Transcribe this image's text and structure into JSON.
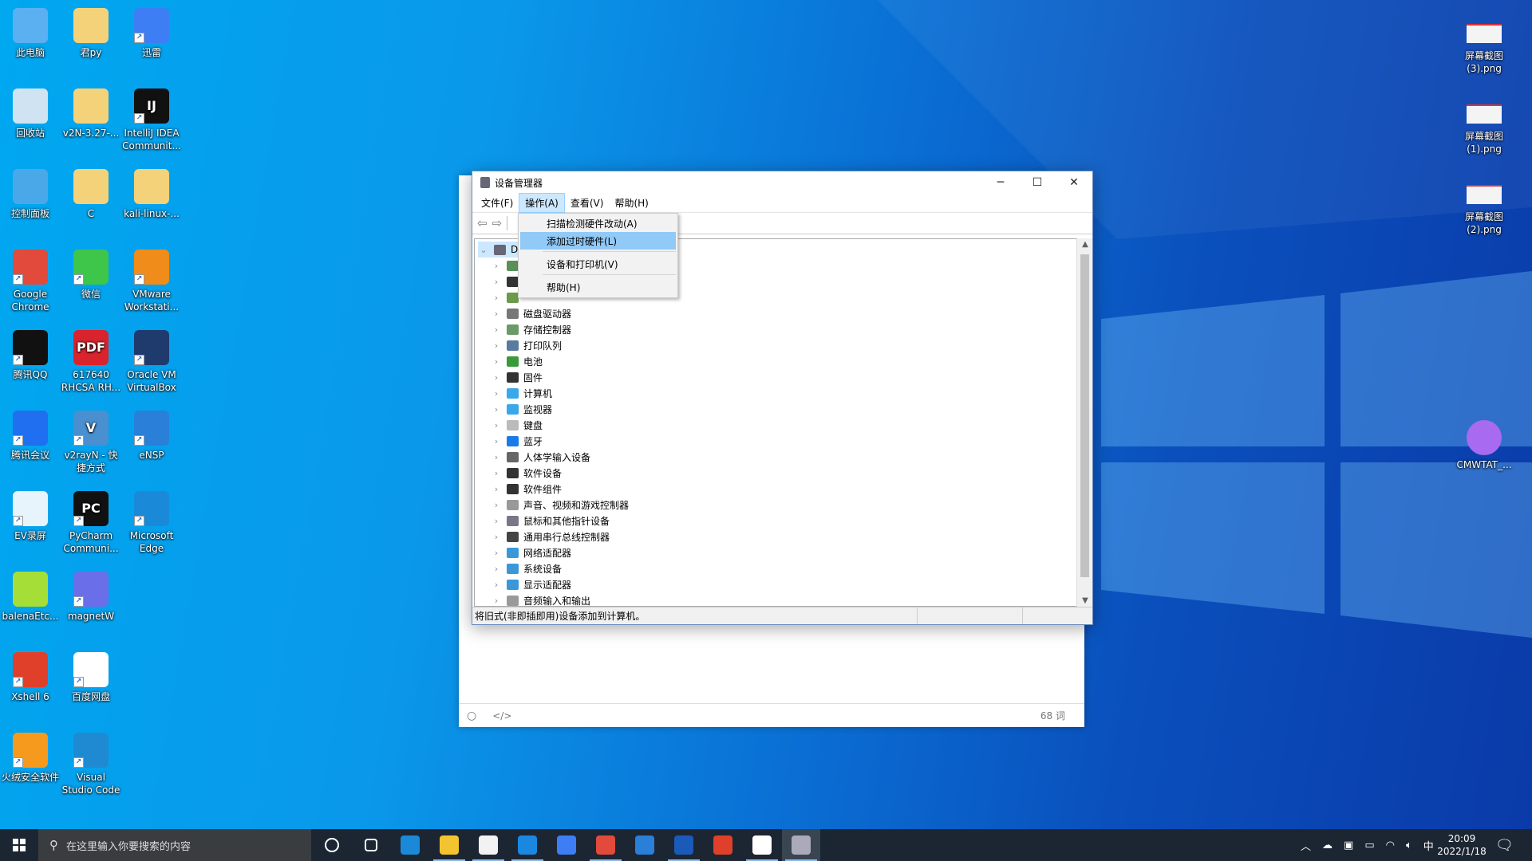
{
  "desktop": {
    "left_icons": [
      {
        "label": "此电脑",
        "icon": "computer-icon",
        "color": "#5ab0f0",
        "col": 0,
        "row": 0
      },
      {
        "label": "君py",
        "icon": "folder-icon",
        "color": "#f4d27a",
        "col": 1,
        "row": 0
      },
      {
        "label": "迅雷",
        "icon": "thunder-icon",
        "color": "#3d7ef5",
        "col": 2,
        "row": 0,
        "shortcut": true
      },
      {
        "label": "回收站",
        "icon": "recycle-bin-icon",
        "color": "#cfe3f2",
        "col": 0,
        "row": 1
      },
      {
        "label": "v2N-3.27-...",
        "icon": "folder-icon",
        "color": "#f4d27a",
        "col": 1,
        "row": 1
      },
      {
        "label": "IntelliJ IDEA Communit...",
        "icon": "intellij-icon",
        "color": "#111",
        "col": 2,
        "row": 1,
        "shortcut": true,
        "glyph": "IJ"
      },
      {
        "label": "控制面板",
        "icon": "control-panel-icon",
        "color": "#4aa8e8",
        "col": 0,
        "row": 2
      },
      {
        "label": "C",
        "icon": "folder-icon",
        "color": "#f4d27a",
        "col": 1,
        "row": 2
      },
      {
        "label": "kali-linux-...",
        "icon": "folder-icon",
        "color": "#f4d27a",
        "col": 2,
        "row": 2
      },
      {
        "label": "Google Chrome",
        "icon": "chrome-icon",
        "color": "#e24a3b",
        "col": 0,
        "row": 3,
        "shortcut": true
      },
      {
        "label": "微信",
        "icon": "wechat-icon",
        "color": "#3ec64a",
        "col": 1,
        "row": 3,
        "shortcut": true
      },
      {
        "label": "VMware Workstati...",
        "icon": "vmware-icon",
        "color": "#f08c1a",
        "col": 2,
        "row": 3,
        "shortcut": true
      },
      {
        "label": "腾讯QQ",
        "icon": "qq-icon",
        "color": "#111",
        "col": 0,
        "row": 4,
        "shortcut": true
      },
      {
        "label": "617640 RHCSA RH...",
        "icon": "pdf-icon",
        "color": "#d9232d",
        "col": 1,
        "row": 4,
        "glyph": "PDF"
      },
      {
        "label": "Oracle VM VirtualBox",
        "icon": "virtualbox-icon",
        "color": "#1f3b6e",
        "col": 2,
        "row": 4,
        "shortcut": true
      },
      {
        "label": "腾讯会议",
        "icon": "tencent-meeting-icon",
        "color": "#1f6ff0",
        "col": 0,
        "row": 5,
        "shortcut": true
      },
      {
        "label": "v2rayN - 快捷方式",
        "icon": "v2rayn-icon",
        "color": "#4a8fd0",
        "col": 1,
        "row": 5,
        "shortcut": true,
        "glyph": "V"
      },
      {
        "label": "eNSP",
        "icon": "ensp-icon",
        "color": "#2a7fd8",
        "col": 2,
        "row": 5,
        "shortcut": true
      },
      {
        "label": "EV录屏",
        "icon": "ev-recorder-icon",
        "color": "#e8f4fb",
        "col": 0,
        "row": 6,
        "shortcut": true
      },
      {
        "label": "PyCharm Communi...",
        "icon": "pycharm-icon",
        "color": "#111",
        "col": 1,
        "row": 6,
        "shortcut": true,
        "glyph": "PC"
      },
      {
        "label": "Microsoft Edge",
        "icon": "edge-icon",
        "color": "#1a8ad8",
        "col": 2,
        "row": 6,
        "shortcut": true
      },
      {
        "label": "balenaEtc...",
        "icon": "balena-etcher-icon",
        "color": "#a5de37",
        "col": 0,
        "row": 7
      },
      {
        "label": "magnetW",
        "icon": "magnetw-icon",
        "color": "#6a6ee8",
        "col": 1,
        "row": 7,
        "shortcut": true
      },
      {
        "label": "Xshell 6",
        "icon": "xshell-icon",
        "color": "#e0402a",
        "col": 0,
        "row": 8,
        "shortcut": true
      },
      {
        "label": "百度网盘",
        "icon": "baidu-netdisk-icon",
        "color": "#ffffff",
        "col": 1,
        "row": 8,
        "shortcut": true
      },
      {
        "label": "火绒安全软件",
        "icon": "huorong-icon",
        "color": "#f59a1c",
        "col": 0,
        "row": 9,
        "shortcut": true
      },
      {
        "label": "Visual Studio Code",
        "icon": "vscode-icon",
        "color": "#1f8ad2",
        "col": 1,
        "row": 9,
        "shortcut": true
      }
    ],
    "right_icons": [
      {
        "label": "屏幕截图 (3).png",
        "icon": "image-file-icon",
        "color": "#f4f4f4",
        "row": 0
      },
      {
        "label": "屏幕截图 (1).png",
        "icon": "image-file-icon",
        "color": "#f4f4f4",
        "row": 1
      },
      {
        "label": "屏幕截图 (2).png",
        "icon": "image-file-icon",
        "color": "#f4f4f4",
        "row": 2
      },
      {
        "label": "CMWTAT_...",
        "icon": "cmwtat-icon",
        "color": "#a86af0",
        "row": 5
      }
    ]
  },
  "editor": {
    "word_count": "68 词"
  },
  "device_manager": {
    "title": "设备管理器",
    "menus": [
      "文件(F)",
      "操作(A)",
      "查看(V)",
      "帮助(H)"
    ],
    "active_menu": 1,
    "root_label": "DI",
    "tree_items": [
      {
        "label": "",
        "color": "#5a8f5a"
      },
      {
        "label": "",
        "color": "#333"
      },
      {
        "label": "",
        "color": "#6a9a4a"
      },
      {
        "label": "磁盘驱动器",
        "color": "#777"
      },
      {
        "label": "存储控制器",
        "color": "#6a9a6a"
      },
      {
        "label": "打印队列",
        "color": "#5a7aa0"
      },
      {
        "label": "电池",
        "color": "#3a9a3a"
      },
      {
        "label": "固件",
        "color": "#333"
      },
      {
        "label": "计算机",
        "color": "#3aa8e8"
      },
      {
        "label": "监视器",
        "color": "#3aa8e8"
      },
      {
        "label": "键盘",
        "color": "#bbb"
      },
      {
        "label": "蓝牙",
        "color": "#1a7ae8"
      },
      {
        "label": "人体学输入设备",
        "color": "#666"
      },
      {
        "label": "软件设备",
        "color": "#333"
      },
      {
        "label": "软件组件",
        "color": "#333"
      },
      {
        "label": "声音、视频和游戏控制器",
        "color": "#999"
      },
      {
        "label": "鼠标和其他指针设备",
        "color": "#778"
      },
      {
        "label": "通用串行总线控制器",
        "color": "#444"
      },
      {
        "label": "网络适配器",
        "color": "#3a98d8"
      },
      {
        "label": "系统设备",
        "color": "#3a98d8"
      },
      {
        "label": "显示适配器",
        "color": "#3a98d8"
      },
      {
        "label": "音频输入和输出",
        "color": "#999"
      }
    ],
    "status_text": "将旧式(非即插即用)设备添加到计算机。",
    "action_menu": {
      "items": [
        {
          "label": "扫描检测硬件改动(A)"
        },
        {
          "label": "添加过时硬件(L)",
          "highlighted": true
        },
        {
          "label": "设备和打印机(V)"
        },
        {
          "label": "帮助(H)"
        }
      ]
    }
  },
  "taskbar": {
    "search_placeholder": "在这里输入你要搜索的内容",
    "apps": [
      {
        "name": "cortana-icon",
        "color": "#1c2633"
      },
      {
        "name": "task-view-icon",
        "color": "#1c2633"
      },
      {
        "name": "edge-icon",
        "color": "#1a8ad8"
      },
      {
        "name": "file-explorer-icon",
        "color": "#f4c430",
        "running": true
      },
      {
        "name": "store-icon",
        "color": "#f2f2f2",
        "running": true
      },
      {
        "name": "mail-icon",
        "color": "#1a88e0",
        "running": true
      },
      {
        "name": "thunder-icon",
        "color": "#3d7ef5"
      },
      {
        "name": "chrome-icon",
        "color": "#e24a3b",
        "running": true
      },
      {
        "name": "ensp-icon",
        "color": "#2a7fd8"
      },
      {
        "name": "photos-icon",
        "color": "#1a5ab8",
        "running": true
      },
      {
        "name": "xshell-icon",
        "color": "#e0402a"
      },
      {
        "name": "typora-icon",
        "color": "#ffffff",
        "running": true
      },
      {
        "name": "device-manager-icon",
        "color": "#aab",
        "running": true,
        "active": true
      }
    ],
    "ime": "中",
    "time": "20:09",
    "date": "2022/1/18"
  }
}
